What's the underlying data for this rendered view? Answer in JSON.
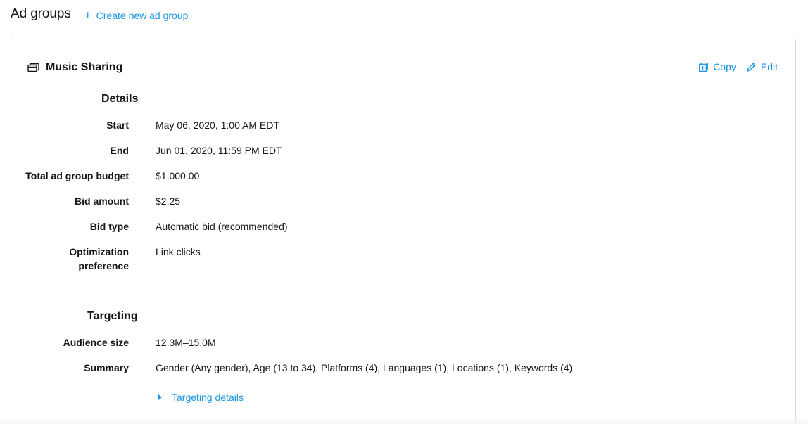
{
  "header": {
    "title": "Ad groups",
    "create_label": "Create new ad group"
  },
  "ad_group": {
    "name": "Music Sharing",
    "icon": "ad-group-icon",
    "actions": {
      "copy_label": "Copy",
      "edit_label": "Edit"
    }
  },
  "details": {
    "title": "Details",
    "rows": [
      {
        "label": "Start",
        "value": "May 06, 2020, 1:00 AM EDT"
      },
      {
        "label": "End",
        "value": "Jun 01, 2020, 11:59 PM EDT"
      },
      {
        "label": "Total ad group budget",
        "value": "$1,000.00"
      },
      {
        "label": "Bid amount",
        "value": "$2.25"
      },
      {
        "label": "Bid type",
        "value": "Automatic bid (recommended)"
      },
      {
        "label_line1": "Optimization",
        "label_line2": "preference",
        "value": "Link clicks"
      }
    ]
  },
  "targeting": {
    "title": "Targeting",
    "rows": [
      {
        "label": "Audience size",
        "value": "12.3M–15.0M"
      },
      {
        "label": "Summary",
        "value": "Gender (Any gender), Age (13 to 34), Platforms (4), Languages (1), Locations (1), Keywords (4)"
      }
    ],
    "details_toggle_label": "Targeting details"
  },
  "colors": {
    "accent": "#1b95e0",
    "text": "#14171a",
    "border": "#d4d7da"
  }
}
